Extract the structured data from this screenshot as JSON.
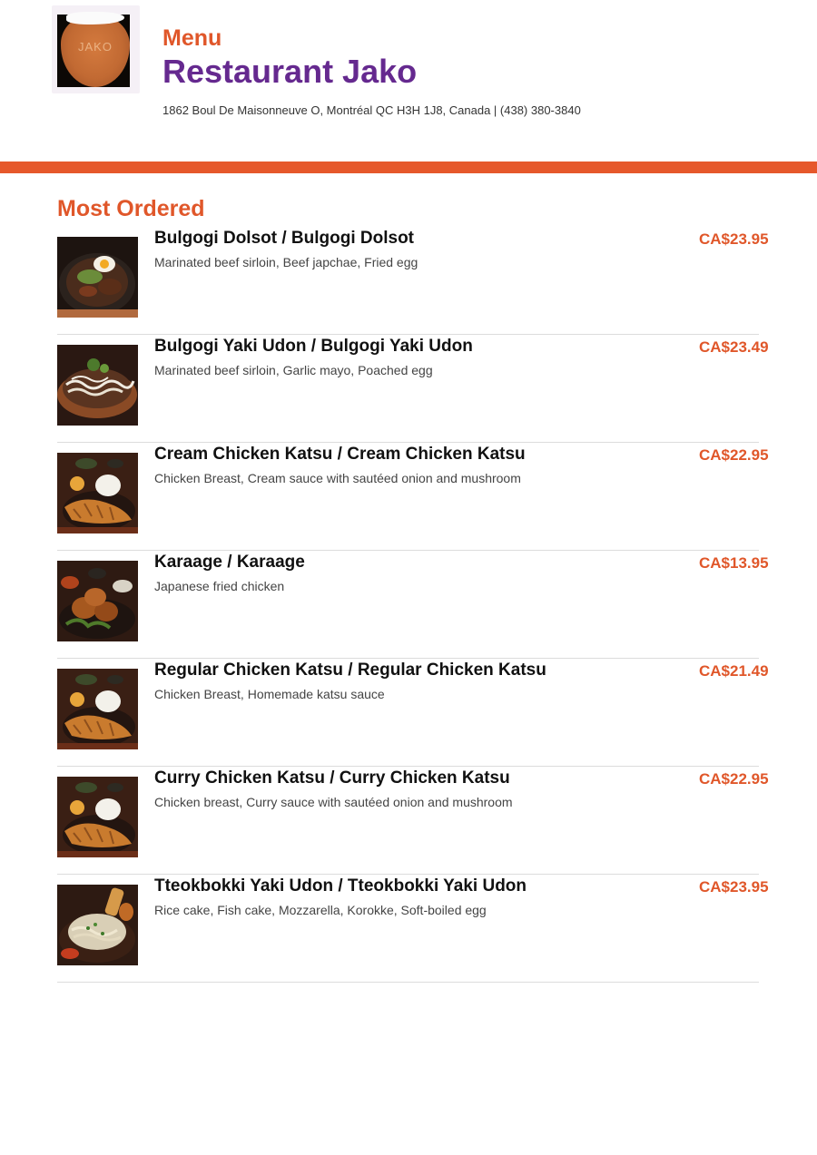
{
  "header": {
    "logo_text": "JAKO",
    "menu_label": "Menu",
    "restaurant_name": "Restaurant Jako",
    "address": "1862 Boul De Maisonneuve O, Montréal QC H3H 1J8, Canada | (438) 380-3840",
    "accent_color": "#e6582b",
    "brand_color": "#65298f"
  },
  "section": {
    "title": "Most Ordered",
    "items": [
      {
        "name": "Bulgogi Dolsot / Bulgogi Dolsot",
        "description": "Marinated beef sirloin, Beef japchae, Fried egg",
        "price": "CA$23.95",
        "photo": "bulgogi-dolsot-photo"
      },
      {
        "name": "Bulgogi Yaki Udon / Bulgogi Yaki Udon",
        "description": "Marinated beef sirloin, Garlic mayo, Poached egg",
        "price": "CA$23.49",
        "photo": "bulgogi-yaki-udon-photo"
      },
      {
        "name": "Cream Chicken Katsu / Cream Chicken Katsu",
        "description": "Chicken Breast, Cream sauce with sautéed onion and mushroom",
        "price": "CA$22.95",
        "photo": "chicken-katsu-photo"
      },
      {
        "name": "Karaage / Karaage",
        "description": "Japanese fried chicken",
        "price": "CA$13.95",
        "photo": "karaage-photo"
      },
      {
        "name": "Regular Chicken Katsu / Regular Chicken Katsu",
        "description": "Chicken Breast, Homemade katsu sauce",
        "price": "CA$21.49",
        "photo": "chicken-katsu-photo"
      },
      {
        "name": "Curry Chicken Katsu / Curry Chicken Katsu",
        "description": "Chicken breast, Curry sauce with sautéed onion and mushroom",
        "price": "CA$22.95",
        "photo": "chicken-katsu-photo"
      },
      {
        "name": "Tteokbokki Yaki Udon / Tteokbokki Yaki Udon",
        "description": "Rice cake, Fish cake, Mozzarella, Korokke, Soft-boiled egg",
        "price": "CA$23.95",
        "photo": "tteokbokki-yaki-udon-photo"
      }
    ]
  }
}
